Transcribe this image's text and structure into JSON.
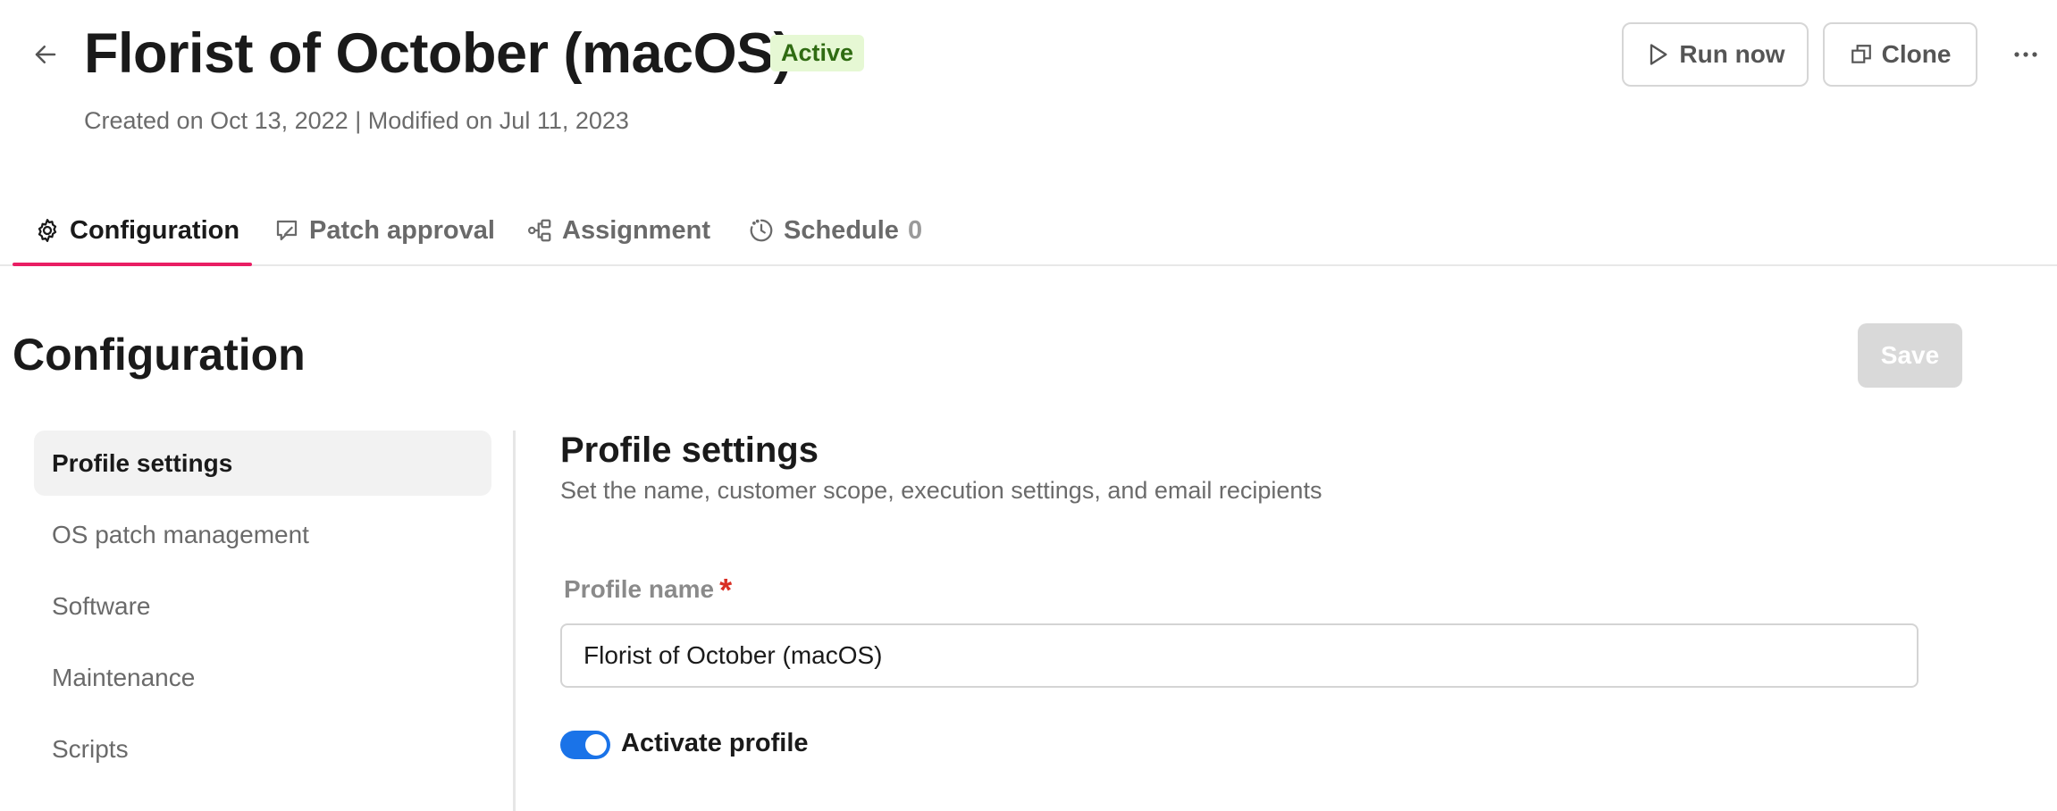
{
  "header": {
    "back_icon": "arrow-left-icon",
    "title": "Florist of October (macOS)",
    "status": "Active",
    "meta": "Created on Oct 13, 2022 | Modified on Jul 11, 2023",
    "run_label": "Run now",
    "run_icon": "play-icon",
    "clone_label": "Clone",
    "clone_icon": "copy-icon",
    "more_icon": "more-horizontal-icon"
  },
  "tabs": [
    {
      "label": "Configuration",
      "icon": "gear-icon",
      "active": true
    },
    {
      "label": "Patch approval",
      "icon": "approval-icon",
      "active": false
    },
    {
      "label": "Assignment",
      "icon": "assignment-icon",
      "active": false
    },
    {
      "label": "Schedule",
      "icon": "schedule-icon",
      "count": "0",
      "active": false
    }
  ],
  "section": {
    "title": "Configuration",
    "save_label": "Save"
  },
  "sidenav": {
    "items": [
      {
        "label": "Profile settings",
        "active": true
      },
      {
        "label": "OS patch management",
        "active": false
      },
      {
        "label": "Software",
        "active": false
      },
      {
        "label": "Maintenance",
        "active": false
      },
      {
        "label": "Scripts",
        "active": false
      }
    ]
  },
  "profile": {
    "title": "Profile settings",
    "subtitle": "Set the name, customer scope, execution settings, and email recipients",
    "name_label": "Profile name",
    "required_mark": "*",
    "name_value": "Florist of October (macOS)",
    "activate_label": "Activate profile",
    "activate_on": true
  },
  "colors": {
    "accent": "#e91e63",
    "toggle_on": "#1a73e8",
    "badge_bg": "#e6f8d4",
    "badge_text": "#2f6b12",
    "required": "#d93025"
  }
}
